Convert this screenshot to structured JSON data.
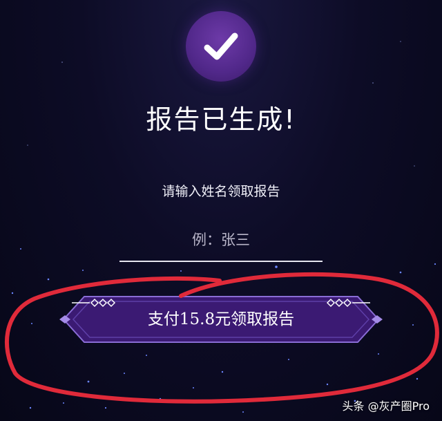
{
  "status": {
    "title": "报告已生成!",
    "icon": "checkmark-icon"
  },
  "form": {
    "prompt": "请输入姓名领取报告",
    "name_placeholder": "例：张三",
    "name_value": ""
  },
  "pay_button": {
    "label": "支付15.8元领取报告"
  },
  "watermark": {
    "text": "头条 @灰产圈Pro"
  },
  "colors": {
    "background": "#0d0c26",
    "badge": "#51288a",
    "button_fill": "#3b1a73",
    "button_border": "#7a5cc4",
    "highlight": "#e02a3a"
  }
}
